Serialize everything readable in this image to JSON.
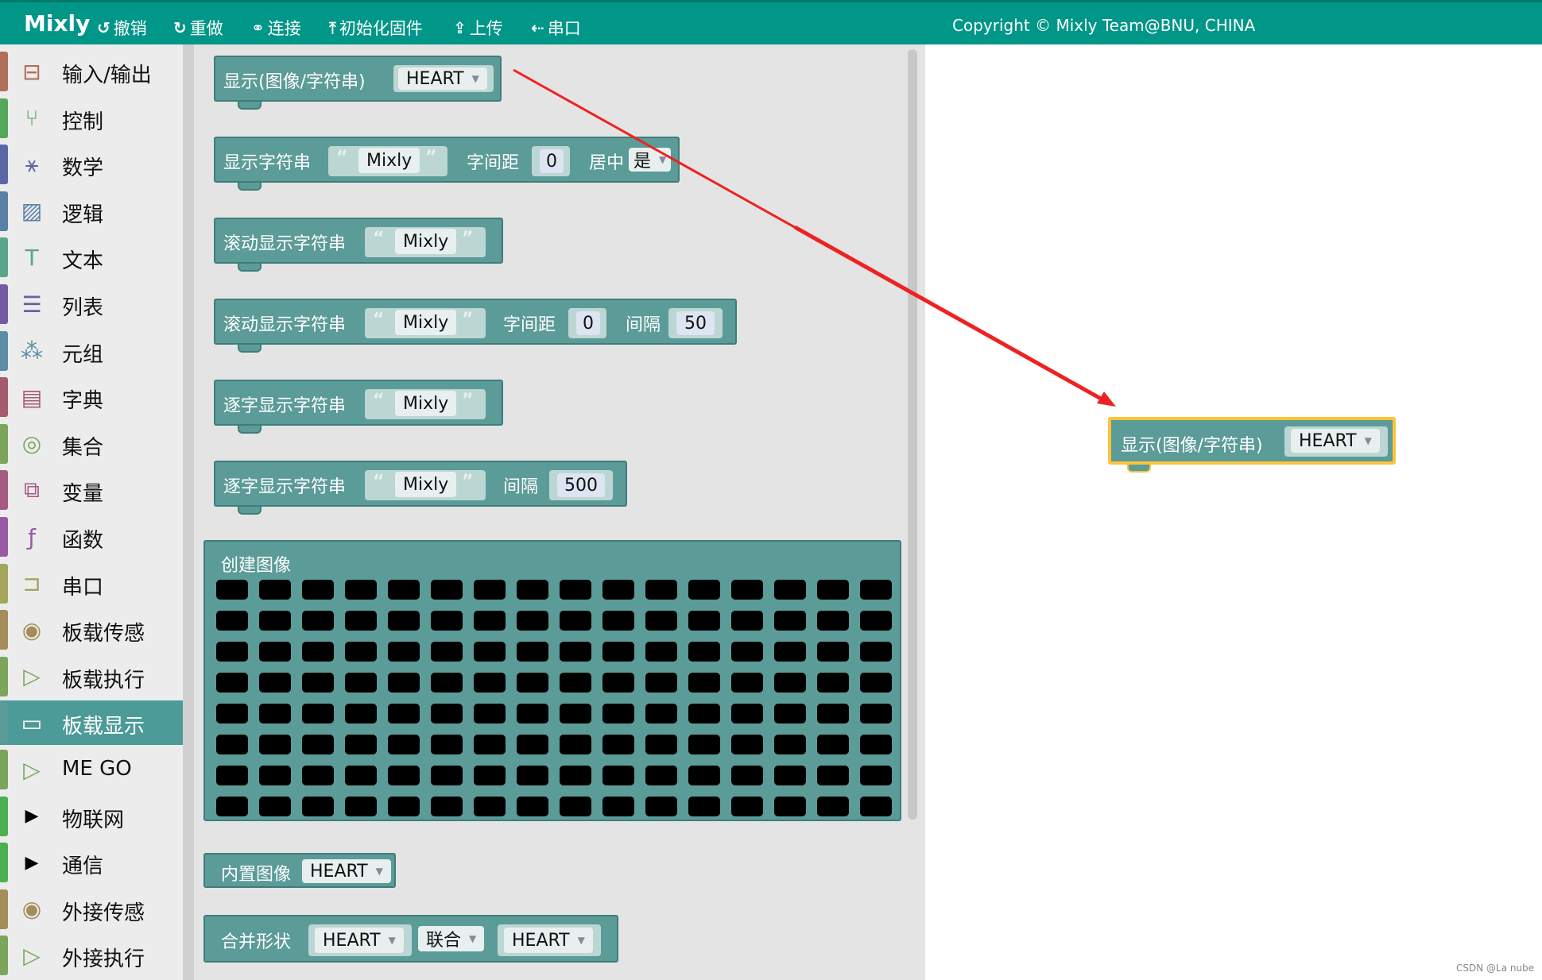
{
  "app": {
    "logo": "Mixly",
    "toolbar": [
      {
        "icon": "undo-icon",
        "glyph": "↺",
        "label": "撤销"
      },
      {
        "icon": "redo-icon",
        "glyph": "↻",
        "label": "重做"
      },
      {
        "icon": "link-icon",
        "glyph": "⚭",
        "label": "连接"
      },
      {
        "icon": "firmware-icon",
        "glyph": "⤒",
        "label": "初始化固件"
      },
      {
        "icon": "upload-icon",
        "glyph": "⇪",
        "label": "上传"
      },
      {
        "icon": "usb-icon",
        "glyph": "⇠",
        "label": "串口"
      }
    ],
    "copyright": "Copyright © Mixly Team@BNU, CHINA"
  },
  "sidebar": {
    "items": [
      {
        "label": "输入/输出",
        "color": "#b06f58",
        "icon": "io-icon"
      },
      {
        "label": "控制",
        "color": "#55a859",
        "icon": "control-icon"
      },
      {
        "label": "数学",
        "color": "#5b67a5",
        "icon": "math-icon"
      },
      {
        "label": "逻辑",
        "color": "#5b80a5",
        "icon": "logic-icon"
      },
      {
        "label": "文本",
        "color": "#5ba58c",
        "icon": "text-icon"
      },
      {
        "label": "列表",
        "color": "#745ba5",
        "icon": "list-icon"
      },
      {
        "label": "元组",
        "color": "#5b8fa5",
        "icon": "tuple-icon"
      },
      {
        "label": "字典",
        "color": "#a55b6c",
        "icon": "dict-icon"
      },
      {
        "label": "集合",
        "color": "#7ba55b",
        "icon": "set-icon"
      },
      {
        "label": "变量",
        "color": "#a55b80",
        "icon": "variable-icon"
      },
      {
        "label": "函数",
        "color": "#995ba5",
        "icon": "function-icon"
      },
      {
        "label": "串口",
        "color": "#a5a55b",
        "icon": "serial-icon"
      },
      {
        "label": "板载传感",
        "color": "#a58c5b",
        "icon": "sensor-icon"
      },
      {
        "label": "板载执行",
        "color": "#7ba55b",
        "icon": "actuator-icon"
      },
      {
        "label": "板载显示",
        "color": "#5b9b98",
        "icon": "display-icon"
      },
      {
        "label": "ME GO",
        "color": "#7ba55b",
        "icon": "mego-icon"
      },
      {
        "label": "物联网",
        "color": "#4caf50",
        "icon": "expand-arrow-icon"
      },
      {
        "label": "通信",
        "color": "#4caf50",
        "icon": "expand-arrow-icon"
      },
      {
        "label": "外接传感",
        "color": "#a58c5b",
        "icon": "sensor-icon"
      },
      {
        "label": "外接执行",
        "color": "#7ba55b",
        "icon": "actuator-icon"
      }
    ],
    "selected": "板载显示"
  },
  "blocks": {
    "show_image": {
      "label": "显示(图像/字符串)",
      "value": "HEART"
    },
    "show_string": {
      "label": "显示字符串",
      "text": "Mixly",
      "spacing_label": "字间距",
      "spacing": "0",
      "center_label": "居中",
      "center": "是"
    },
    "scroll_string": {
      "label": "滚动显示字符串",
      "text": "Mixly"
    },
    "scroll_string2": {
      "label": "滚动显示字符串",
      "text": "Mixly",
      "spacing_label": "字间距",
      "spacing": "0",
      "interval_label": "间隔",
      "interval": "50"
    },
    "char_string": {
      "label": "逐字显示字符串",
      "text": "Mixly"
    },
    "char_string2": {
      "label": "逐字显示字符串",
      "text": "Mixly",
      "interval_label": "间隔",
      "interval": "500"
    },
    "create_image": {
      "label": "创建图像",
      "rows": 8,
      "cols": 16
    },
    "builtin_image": {
      "label": "内置图像",
      "value": "HEART"
    },
    "merge_shape": {
      "label": "合并形状",
      "a": "HEART",
      "op": "联合",
      "b": "HEART"
    }
  },
  "quotes": {
    "open": "“",
    "close": "”"
  },
  "canvas_block": {
    "label": "显示(图像/字符串)",
    "value": "HEART"
  },
  "watermark": "CSDN @La nube"
}
